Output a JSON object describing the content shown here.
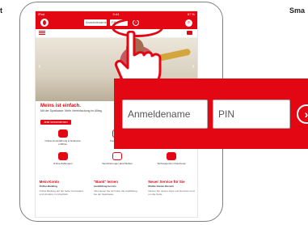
{
  "labels": {
    "left_cut": "t",
    "right_cut": "Sma"
  },
  "screen": {
    "status_time": "9:44",
    "status_right": "67 %",
    "top_login_placeholder": "Anmeldename",
    "top_pin_placeholder": "PIN",
    "go_arrow": "›",
    "search_icon": "search-icon"
  },
  "hero": {
    "title": "Meins ist einfach.",
    "subtitle": "Mit der Sparkasse: Mehr Vereinfachung im Alltag.",
    "button": "Jetzt kennenlernen"
  },
  "tiles": [
    {
      "label": "Online-Kontoführung & Girokonto eröffnen"
    },
    {
      "label": "Kreditanfrage"
    },
    {
      "label": "Online-Sicherheit & Geldanlage"
    },
    {
      "label": "Online-Zahlungen"
    },
    {
      "label": "Versicherungen abschließen"
    },
    {
      "label": "Wohneigentum finanzieren"
    }
  ],
  "bottom": [
    {
      "title": "Mein Konto",
      "sub": "Online-Banking",
      "text": "Online Banking auf der Seite Kontostand und Umsätze im Überblick."
    },
    {
      "title": "\"Bank\" lernen",
      "sub": "Ausbildung bei uns",
      "text": "Informieren Sie sich über die Ausbildung bei der Sparkasse."
    },
    {
      "title": "Neuer Service für Sie",
      "sub": "Mobile Karten-Dienste",
      "text": "Nutzen Sie unsere Apps und Services rund um die Karte."
    }
  ],
  "zoom": {
    "username_placeholder": "Anmeldename",
    "pin_placeholder": "PIN",
    "go_arrow": "›"
  },
  "colors": {
    "brand_red": "#e30613"
  }
}
